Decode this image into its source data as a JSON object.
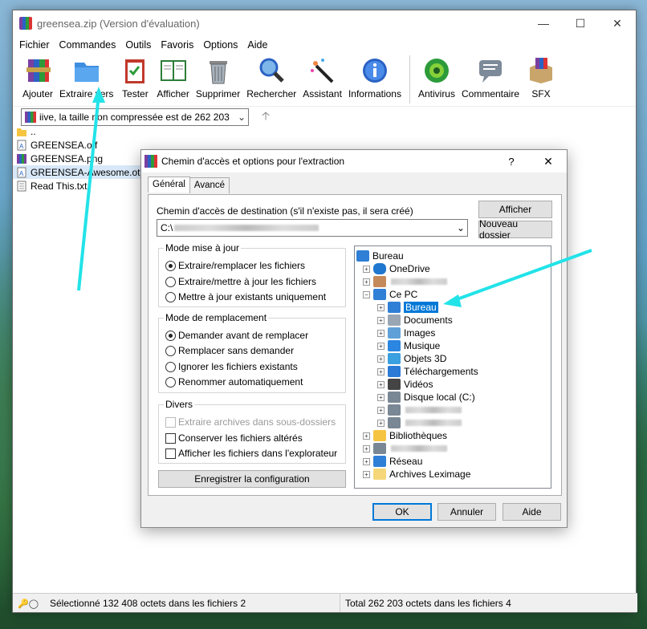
{
  "app": {
    "title": "greensea.zip (Version d'évaluation)",
    "menu": [
      "Fichier",
      "Commandes",
      "Outils",
      "Favoris",
      "Options",
      "Aide"
    ],
    "toolbar": [
      {
        "label": "Ajouter",
        "icon": "add-archive-icon"
      },
      {
        "label": "Extraire vers",
        "icon": "extract-folder-icon"
      },
      {
        "label": "Tester",
        "icon": "test-clipboard-icon"
      },
      {
        "label": "Afficher",
        "icon": "view-book-icon"
      },
      {
        "label": "Supprimer",
        "icon": "trash-icon"
      },
      {
        "label": "Rechercher",
        "icon": "search-icon"
      },
      {
        "label": "Assistant",
        "icon": "wizard-wand-icon"
      },
      {
        "label": "Informations",
        "icon": "info-icon"
      },
      {
        "label": "Antivirus",
        "icon": "antivirus-bug-icon"
      },
      {
        "label": "Commentaire",
        "icon": "comment-icon"
      },
      {
        "label": "SFX",
        "icon": "sfx-box-icon"
      }
    ],
    "address": "iive, la taille non compressée est de 262 203",
    "files": [
      {
        "name": "..",
        "icon": "folder-icon"
      },
      {
        "name": "GREENSEA.otf",
        "icon": "font-file-icon"
      },
      {
        "name": "GREENSEA.png",
        "icon": "image-file-icon"
      },
      {
        "name": "GREENSEA-Awesome.otf",
        "icon": "font-file-icon"
      },
      {
        "name": "Read This.txt",
        "icon": "text-file-icon"
      }
    ],
    "status_left": "Sélectionné 132 408 octets dans les fichiers 2",
    "status_right": "Total 262 203 octets dans les fichiers 4"
  },
  "dialog": {
    "title": "Chemin d'accès et options pour l'extraction",
    "help": "?",
    "close": "✕",
    "tabs": [
      "Général",
      "Avancé"
    ],
    "dest_label": "Chemin d'accès de destination (s'il n'existe pas, il sera créé)",
    "dest_value": "C:\\",
    "btn_afficher": "Afficher",
    "btn_nouveau": "Nouveau dossier",
    "update_mode": {
      "title": "Mode mise à jour",
      "options": [
        "Extraire/remplacer les fichiers",
        "Extraire/mettre à jour les fichiers",
        "Mettre à jour existants uniquement"
      ],
      "selected": 0
    },
    "overwrite_mode": {
      "title": "Mode de remplacement",
      "options": [
        "Demander avant de remplacer",
        "Remplacer sans demander",
        "Ignorer les fichiers existants",
        "Renommer automatiquement"
      ],
      "selected": 0
    },
    "misc": {
      "title": "Divers",
      "options": [
        "Extraire archives dans sous-dossiers",
        "Conserver les fichiers altérés",
        "Afficher les fichiers dans l'explorateur"
      ]
    },
    "btn_save": "Enregistrer la configuration",
    "tree": [
      {
        "label": "Bureau",
        "icon": "desktop-icon"
      },
      {
        "label": "OneDrive",
        "icon": "cloud-icon"
      },
      {
        "label": "",
        "icon": "user-icon"
      },
      {
        "label": "Ce PC",
        "icon": "computer-icon"
      },
      {
        "label": "Bureau",
        "icon": "desktop-icon"
      },
      {
        "label": "Documents",
        "icon": "documents-icon"
      },
      {
        "label": "Images",
        "icon": "images-icon"
      },
      {
        "label": "Musique",
        "icon": "music-icon"
      },
      {
        "label": "Objets 3D",
        "icon": "cube-icon"
      },
      {
        "label": "Téléchargements",
        "icon": "download-icon"
      },
      {
        "label": "Vidéos",
        "icon": "video-icon"
      },
      {
        "label": "Disque local (C:)",
        "icon": "drive-icon"
      },
      {
        "label": "",
        "icon": "drive-icon"
      },
      {
        "label": "",
        "icon": "drive-icon"
      },
      {
        "label": "Bibliothèques",
        "icon": "library-icon"
      },
      {
        "label": "",
        "icon": "drive-icon"
      },
      {
        "label": "Réseau",
        "icon": "network-icon"
      },
      {
        "label": "Archives Leximage",
        "icon": "folder-icon"
      }
    ],
    "btn_ok": "OK",
    "btn_cancel": "Annuler",
    "btn_help": "Aide"
  },
  "colors": {
    "accent": "#0078d7",
    "annotation_arrow": "#22e3e8"
  }
}
